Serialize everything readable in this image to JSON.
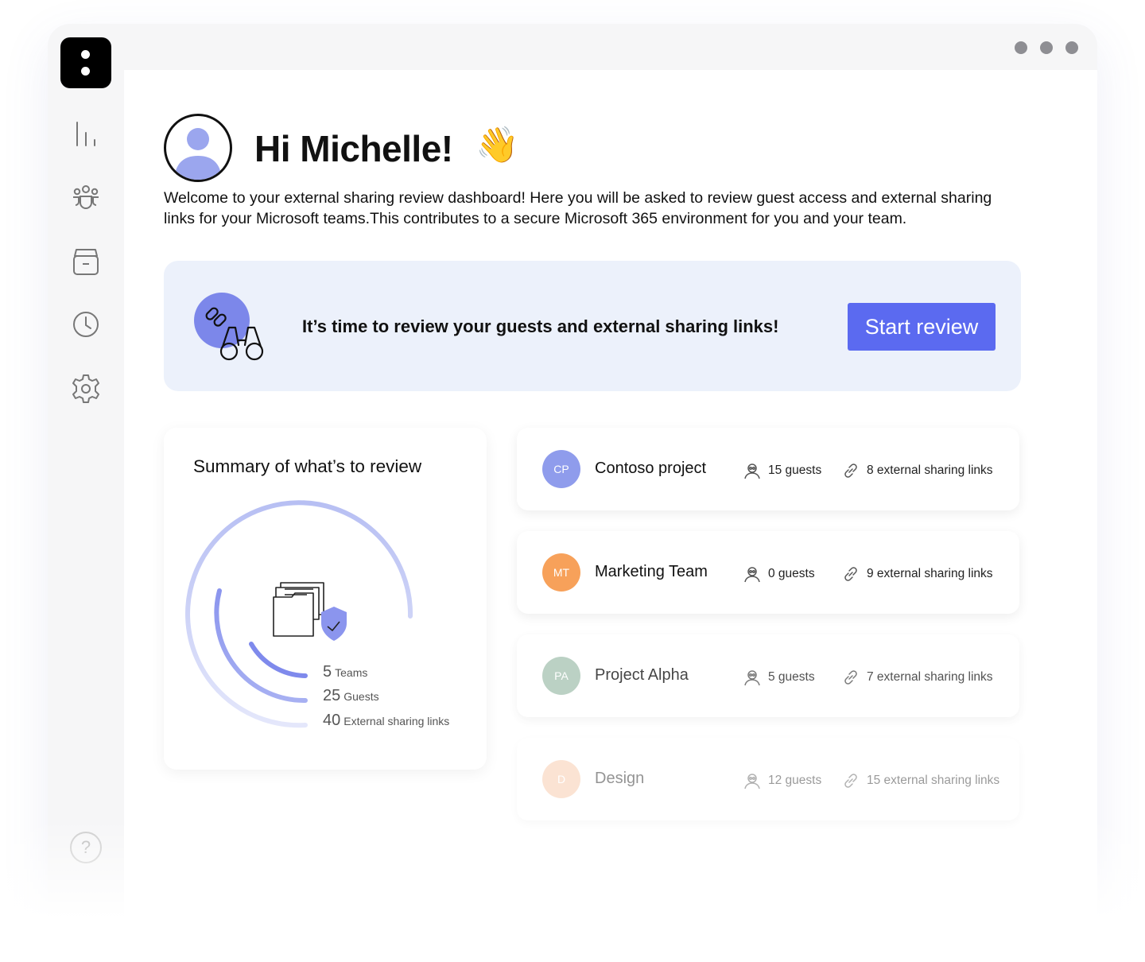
{
  "user": {
    "greeting": "Hi Michelle!",
    "wave_emoji": "👋"
  },
  "intro_text": "Welcome to your external sharing review dashboard! Here you will be asked to review guest access and external sharing links for your Microsoft teams.This contributes to a secure Microsoft 365 environment for you and your team.",
  "banner": {
    "text": "It’s time to review your guests and external sharing links!",
    "button_label": "Start review"
  },
  "sidebar": {
    "items": [
      {
        "name": "analytics",
        "icon": "bar-chart-icon"
      },
      {
        "name": "teams",
        "icon": "people-group-icon"
      },
      {
        "name": "archive",
        "icon": "archive-icon"
      },
      {
        "name": "history",
        "icon": "clock-icon"
      },
      {
        "name": "settings",
        "icon": "gear-icon"
      }
    ],
    "help_glyph": "?"
  },
  "summary": {
    "title": "Summary of what’s to review",
    "stats": [
      {
        "value": "5",
        "label": "Teams"
      },
      {
        "value": "25",
        "label": "Guests"
      },
      {
        "value": "40",
        "label": "External sharing links"
      }
    ]
  },
  "teams": [
    {
      "initials": "CP",
      "name": "Contoso project",
      "guests": "15 guests",
      "links": "8 external sharing links",
      "color": "#8f9cec"
    },
    {
      "initials": "MT",
      "name": "Marketing Team",
      "guests": "0 guests",
      "links": "9 external sharing links",
      "color": "#f7a15a"
    },
    {
      "initials": "PA",
      "name": "Project Alpha",
      "guests": "5 guests",
      "links": "7 external sharing links",
      "color": "#a8c5b4"
    },
    {
      "initials": "D",
      "name": "Design",
      "guests": "12 guests",
      "links": "15 external sharing links",
      "color": "#f7c3a0"
    }
  ],
  "colors": {
    "accent": "#5b6af0",
    "banner_bg": "#ecf1fb",
    "ring_light": "#c6ccf5",
    "ring_mid": "#a4adf2",
    "ring_dark": "#7f8aec"
  }
}
